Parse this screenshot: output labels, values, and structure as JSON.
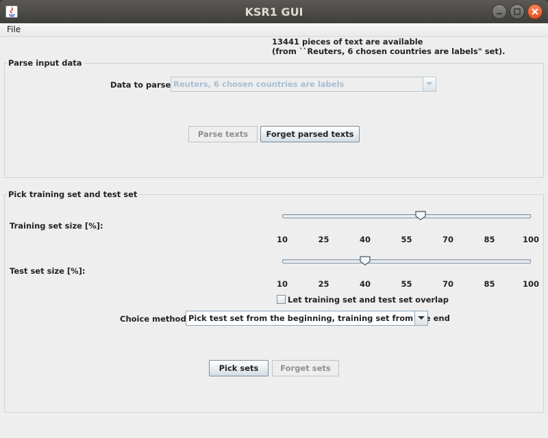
{
  "window": {
    "title": "KSR1 GUI"
  },
  "menu": {
    "file": "File"
  },
  "info": {
    "line1": "13441 pieces of text are available",
    "line2": "(from ``Reuters, 6 chosen countries are labels\" set)."
  },
  "parse_panel": {
    "title": "Parse input data",
    "data_label": "Data to parse:",
    "data_value": "Reuters, 6 chosen countries are labels",
    "parse_button": "Parse texts",
    "forget_button": "Forget parsed texts"
  },
  "pick_panel": {
    "title": "Pick training set and test set",
    "training_label": "Training set size [%]:",
    "training_value_percent": 60,
    "test_label": "Test set size [%]:",
    "test_value_percent": 40,
    "slider_min": 10,
    "slider_max": 100,
    "ticks": [
      "10",
      "25",
      "40",
      "55",
      "70",
      "85",
      "100"
    ],
    "overlap_label": "Let training set and test set overlap",
    "overlap_checked": false,
    "method_label": "Choice method:",
    "method_value": "Pick test set from the beginning, training set from the end",
    "pick_button": "Pick sets",
    "forget_button": "Forget sets"
  }
}
